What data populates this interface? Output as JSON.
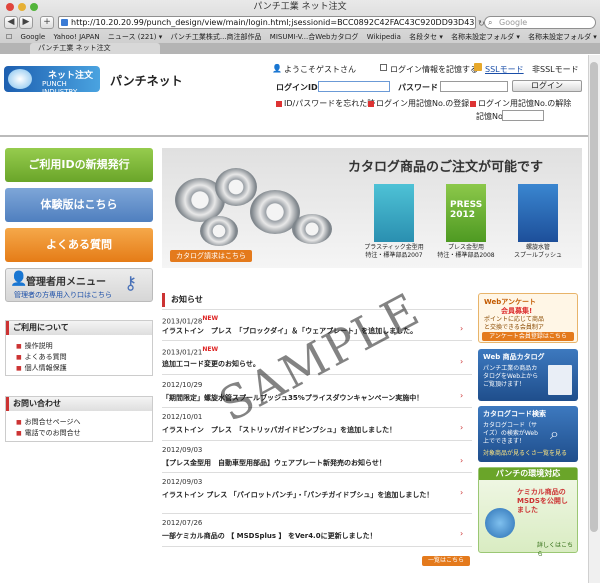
{
  "browser": {
    "window_title": "パンチ工業 ネット注文",
    "url": "http://10.20.20.99/punch_design/view/main/login.html;jsessionid=BCC0892C42FAC43C920DD93D4328255",
    "search_placeholder": "Google",
    "bookmarks": [
      "Google",
      "Yahoo! JAPAN",
      "ニュース (221) ▾",
      "パンチ工業株式...商注部作品",
      "MISUMI-V...合Webカタログ",
      "Wikipedia",
      "名段タセ ▾",
      "名称未設定フォルダ ▾",
      "名称未設定フォルダ ▾"
    ],
    "tab_label": "パンチ工業 ネット注文"
  },
  "header": {
    "logo_line1": "ネット注文",
    "logo_line2": "PUNCH INDUSTRY",
    "site_name": "パンチネット",
    "welcome": "ようこそゲストさん",
    "remember_label": "ログイン情報を記憶する",
    "ssl_mode": "SSLモード",
    "non_ssl_mode": "非SSLモード",
    "login_id_label": "ログインID",
    "password_label": "パスワード",
    "login_button": "ログイン",
    "forgot_link": "ID/パスワードを忘れた時",
    "register_link": "ログイン用記憶No.の登録",
    "release_link": "ログイン用記憶No.の解除",
    "memory_no_label": "記憶No."
  },
  "left_nav": {
    "new_id": "ご利用IDの新規発行",
    "trial": "体験版はこちら",
    "faq": "よくある質問",
    "admin_title": "管理者用メニュー",
    "admin_sub": "管理者の方専用入り口はこちら",
    "usage_title": "ご利用について",
    "usage_items": [
      "操作説明",
      "よくある質問",
      "個人情報保護"
    ],
    "contact_title": "お問い合わせ",
    "contact_items": [
      "お問合せページへ",
      "電話でのお問合せ"
    ]
  },
  "banner": {
    "title": "カタログ商品のご注文が可能です",
    "request_button": "カタログ請求はこちら",
    "catalogs": [
      {
        "caption": "プラスティック金型用\n特注・標準部品2007"
      },
      {
        "caption": "プレス金型用\n特注・標準部品2008"
      },
      {
        "caption": "螺旋水管\nスプールブッシュ"
      }
    ],
    "catalog_cover_text": "PRESS\n2012"
  },
  "news": {
    "title": "お知らせ",
    "new_tag": "NEW",
    "items": [
      {
        "date": "2013/01/28",
        "new": true,
        "text": "イラストイン　プレス　「ブロックダイ」＆「ウェアプレート」を追加しました。"
      },
      {
        "date": "2013/01/21",
        "new": true,
        "text": "追加工コード変更のお知らせ。"
      },
      {
        "date": "2012/10/29",
        "new": false,
        "text": "「期間限定」螺旋水管スプールブッシュ35%プライスダウンキャンペーン実施中！"
      },
      {
        "date": "2012/10/01",
        "new": false,
        "text": "イラストイン　プレス　「ストリッパガイドピンブシュ」を追加しました！"
      },
      {
        "date": "2012/09/03",
        "new": false,
        "text": "【プレス金型用　自動車型用部品】ウェアプレート新発売のお知らせ！"
      },
      {
        "date": "2012/09/03",
        "new": false,
        "text": "イラストイン プレス 「パイロットパンチ」・「パンチガイドブシュ」を追加しました！"
      },
      {
        "date": "2012/07/26",
        "new": false,
        "text": "一部ケミカル商品の 【 MSDSplus 】 をVer4.0に更新しました！"
      }
    ],
    "more_button": "一覧はこちら"
  },
  "right_promos": {
    "web_enquete_title": "Webアンケート",
    "web_enquete_sub": "会員募集!",
    "web_enquete_desc": "ポイントに応じて商品と交換できる会員制アンケート",
    "web_enquete_btn": "アンケート会員登録はこちら",
    "web_catalog_title": "Web 商品カタログ",
    "web_catalog_desc": "パンチ工業の商品カタログをWeb上からご覧頂けます！",
    "catalog_code_title": "カタログコード検索",
    "catalog_code_desc": "カタログコード（サイズ）の検索がWeb上でできます！",
    "catalog_code_desc2": "対象商品が見るくさ一覧を見る",
    "env_title": "パンチの環境対応",
    "env_desc": "ケミカル商品のMSDSを公開しました",
    "env_more": "詳しくはこちら"
  },
  "watermark": "SAMPLE"
}
